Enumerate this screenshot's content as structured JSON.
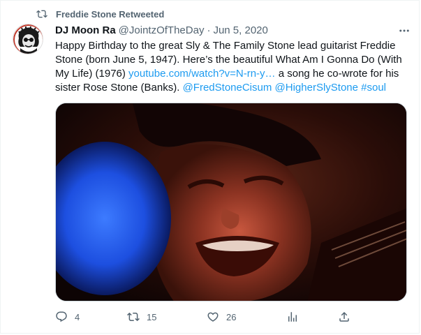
{
  "retweet": {
    "icon": "retweet-icon",
    "label": "Freddie Stone Retweeted"
  },
  "tweet": {
    "author_name": "DJ Moon Ra",
    "handle": "@JointzOfTheDay",
    "separator": "·",
    "date": "Jun 5, 2020",
    "text_part1": "Happy Birthday to the great Sly & The Family Stone lead guitarist Freddie Stone (born June 5, 1947). Here’s the beautiful What Am I Gonna Do (With My Life) (1976) ",
    "link": "youtube.com/watch?v=N-rn-y…",
    "text_part2": " a song he co-wrote for his sister Rose Stone (Banks). ",
    "mention1": "@FredStoneCisum",
    "mention2": "@HigherSlyStone",
    "hashtag": "#soul"
  },
  "actions": {
    "reply_count": "4",
    "retweet_count": "15",
    "like_count": "26"
  },
  "icons": {
    "more": "more-icon",
    "reply": "reply-icon",
    "retweet": "retweet-icon",
    "like": "heart-icon",
    "views": "views-icon",
    "share": "share-icon"
  },
  "colors": {
    "link": "#1d9bf0",
    "secondary_text": "#536471",
    "primary_text": "#0f1419"
  }
}
